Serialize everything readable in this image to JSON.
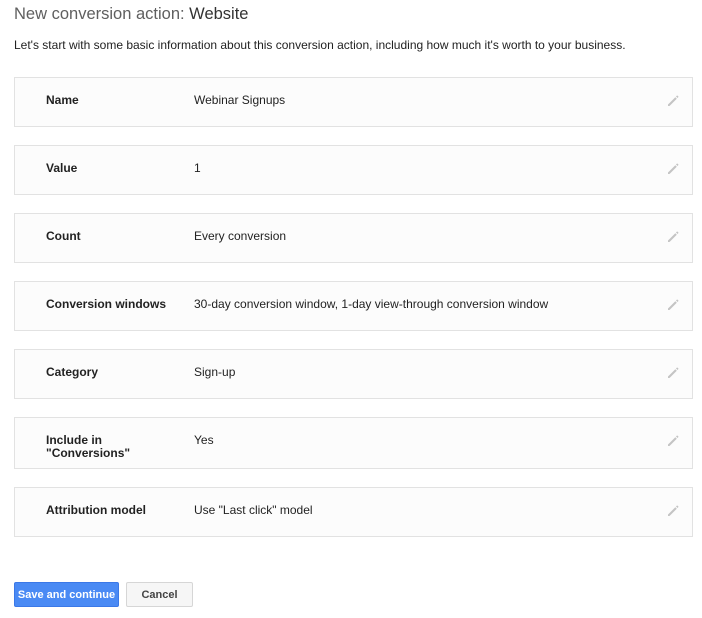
{
  "header": {
    "title_prefix": "New conversion action: ",
    "title_name": "Website",
    "intro": "Let's start with some basic information about this conversion action, including how much it's worth to your business."
  },
  "settings": [
    {
      "label": "Name",
      "value": "Webinar Signups"
    },
    {
      "label": "Value",
      "value": "1"
    },
    {
      "label": "Count",
      "value": "Every conversion"
    },
    {
      "label": "Conversion windows",
      "value": "30-day conversion window, 1-day view-through conversion window"
    },
    {
      "label": "Category",
      "value": "Sign-up"
    },
    {
      "label": "Include in \"Conversions\"",
      "value": "Yes"
    },
    {
      "label": "Attribution model",
      "value": "Use \"Last click\" model"
    }
  ],
  "actions": {
    "save_label": "Save and continue",
    "cancel_label": "Cancel"
  },
  "colors": {
    "primary_button": "#4a8af4",
    "row_border": "#e2e2e2",
    "edit_icon": "#c4c4c4"
  },
  "icons": {
    "edit": "pencil-icon"
  }
}
